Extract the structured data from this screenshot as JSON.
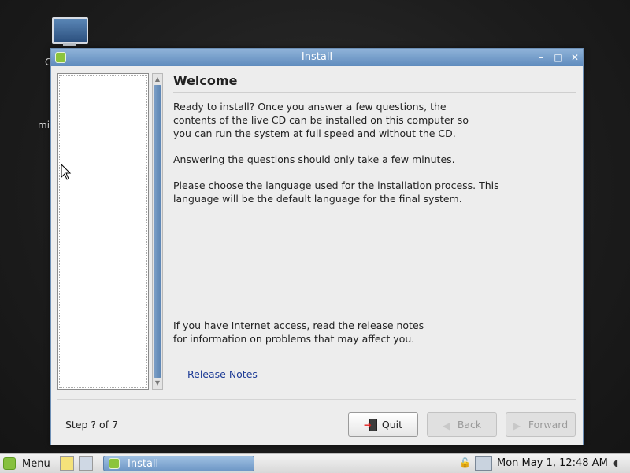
{
  "desktop": {
    "icon_label_fragment_1": "C",
    "icon_label_fragment_2": "mi"
  },
  "window": {
    "title": "Install",
    "controls": {
      "minimize": "–",
      "maximize": "□",
      "close": "✕"
    }
  },
  "page": {
    "heading": "Welcome",
    "paragraph_1": "Ready to install? Once you answer a few questions, the contents of the live CD can be installed on this computer so you can run the system at full speed and without the CD.",
    "paragraph_2": "Answering the questions should only take a few minutes.",
    "paragraph_3": "Please choose the language used for the installation process. This language will be the default language for the final system.",
    "paragraph_4": "If you have Internet access, read the release notes for information on problems that may affect you.",
    "release_notes_link": "Release Notes"
  },
  "footer": {
    "step_text": "Step ? of 7",
    "quit_label": "Quit",
    "back_label": "Back",
    "forward_label": "Forward"
  },
  "taskbar": {
    "menu_label": "Menu",
    "task_label": "Install",
    "clock": "Mon May  1, 12:48 AM"
  }
}
